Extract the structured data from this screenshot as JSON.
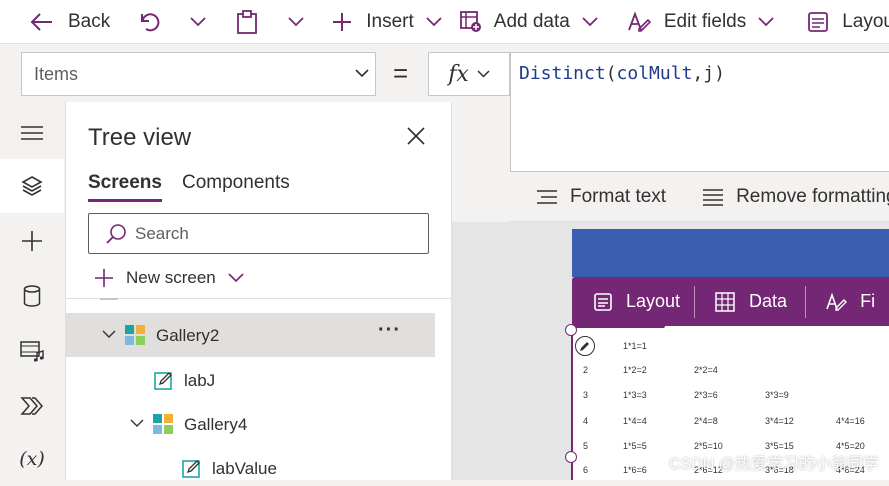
{
  "toolbar": {
    "back_label": "Back",
    "insert_label": "Insert",
    "add_data_label": "Add data",
    "edit_fields_label": "Edit fields",
    "layout_label": "Layout"
  },
  "formula": {
    "property": "Items",
    "equals": "=",
    "fx": "fx",
    "fn": "Distinct",
    "open": "(",
    "arg1": "colMult",
    "comma": ",",
    "arg2": "j",
    "close": ")"
  },
  "format_bar": {
    "format_text": "Format text",
    "remove_formatting": "Remove formatting"
  },
  "tree": {
    "title": "Tree view",
    "tab_screens": "Screens",
    "tab_components": "Components",
    "search_placeholder": "Search",
    "new_screen": "New screen",
    "nodes": {
      "gallery2": "Gallery2",
      "labj": "labJ",
      "gallery4": "Gallery4",
      "labvalue": "labValue"
    },
    "more": "···"
  },
  "canvas": {
    "gallery_toolbar": {
      "layout": "Layout",
      "data": "Data",
      "fields_partial": "Fi"
    },
    "rows": [
      {
        "index": "",
        "cells": [
          "1*1=1"
        ]
      },
      {
        "index": "2",
        "cells": [
          "1*2=2",
          "2*2=4"
        ]
      },
      {
        "index": "3",
        "cells": [
          "1*3=3",
          "2*3=6",
          "3*3=9"
        ]
      },
      {
        "index": "4",
        "cells": [
          "1*4=4",
          "2*4=8",
          "3*4=12",
          "4*4=16"
        ]
      },
      {
        "index": "5",
        "cells": [
          "1*5=5",
          "2*5=10",
          "3*5=15",
          "4*5=20"
        ]
      },
      {
        "index": "6",
        "cells": [
          "1*6=6",
          "2*6=12",
          "3*6=18",
          "4*6=24"
        ]
      }
    ],
    "watermark": "CSDN @热爱学习的小翁同学"
  },
  "colors": {
    "accent": "#742774",
    "gallery_header": "#3a5eb0",
    "formula_fn": "#1e3a8a"
  }
}
